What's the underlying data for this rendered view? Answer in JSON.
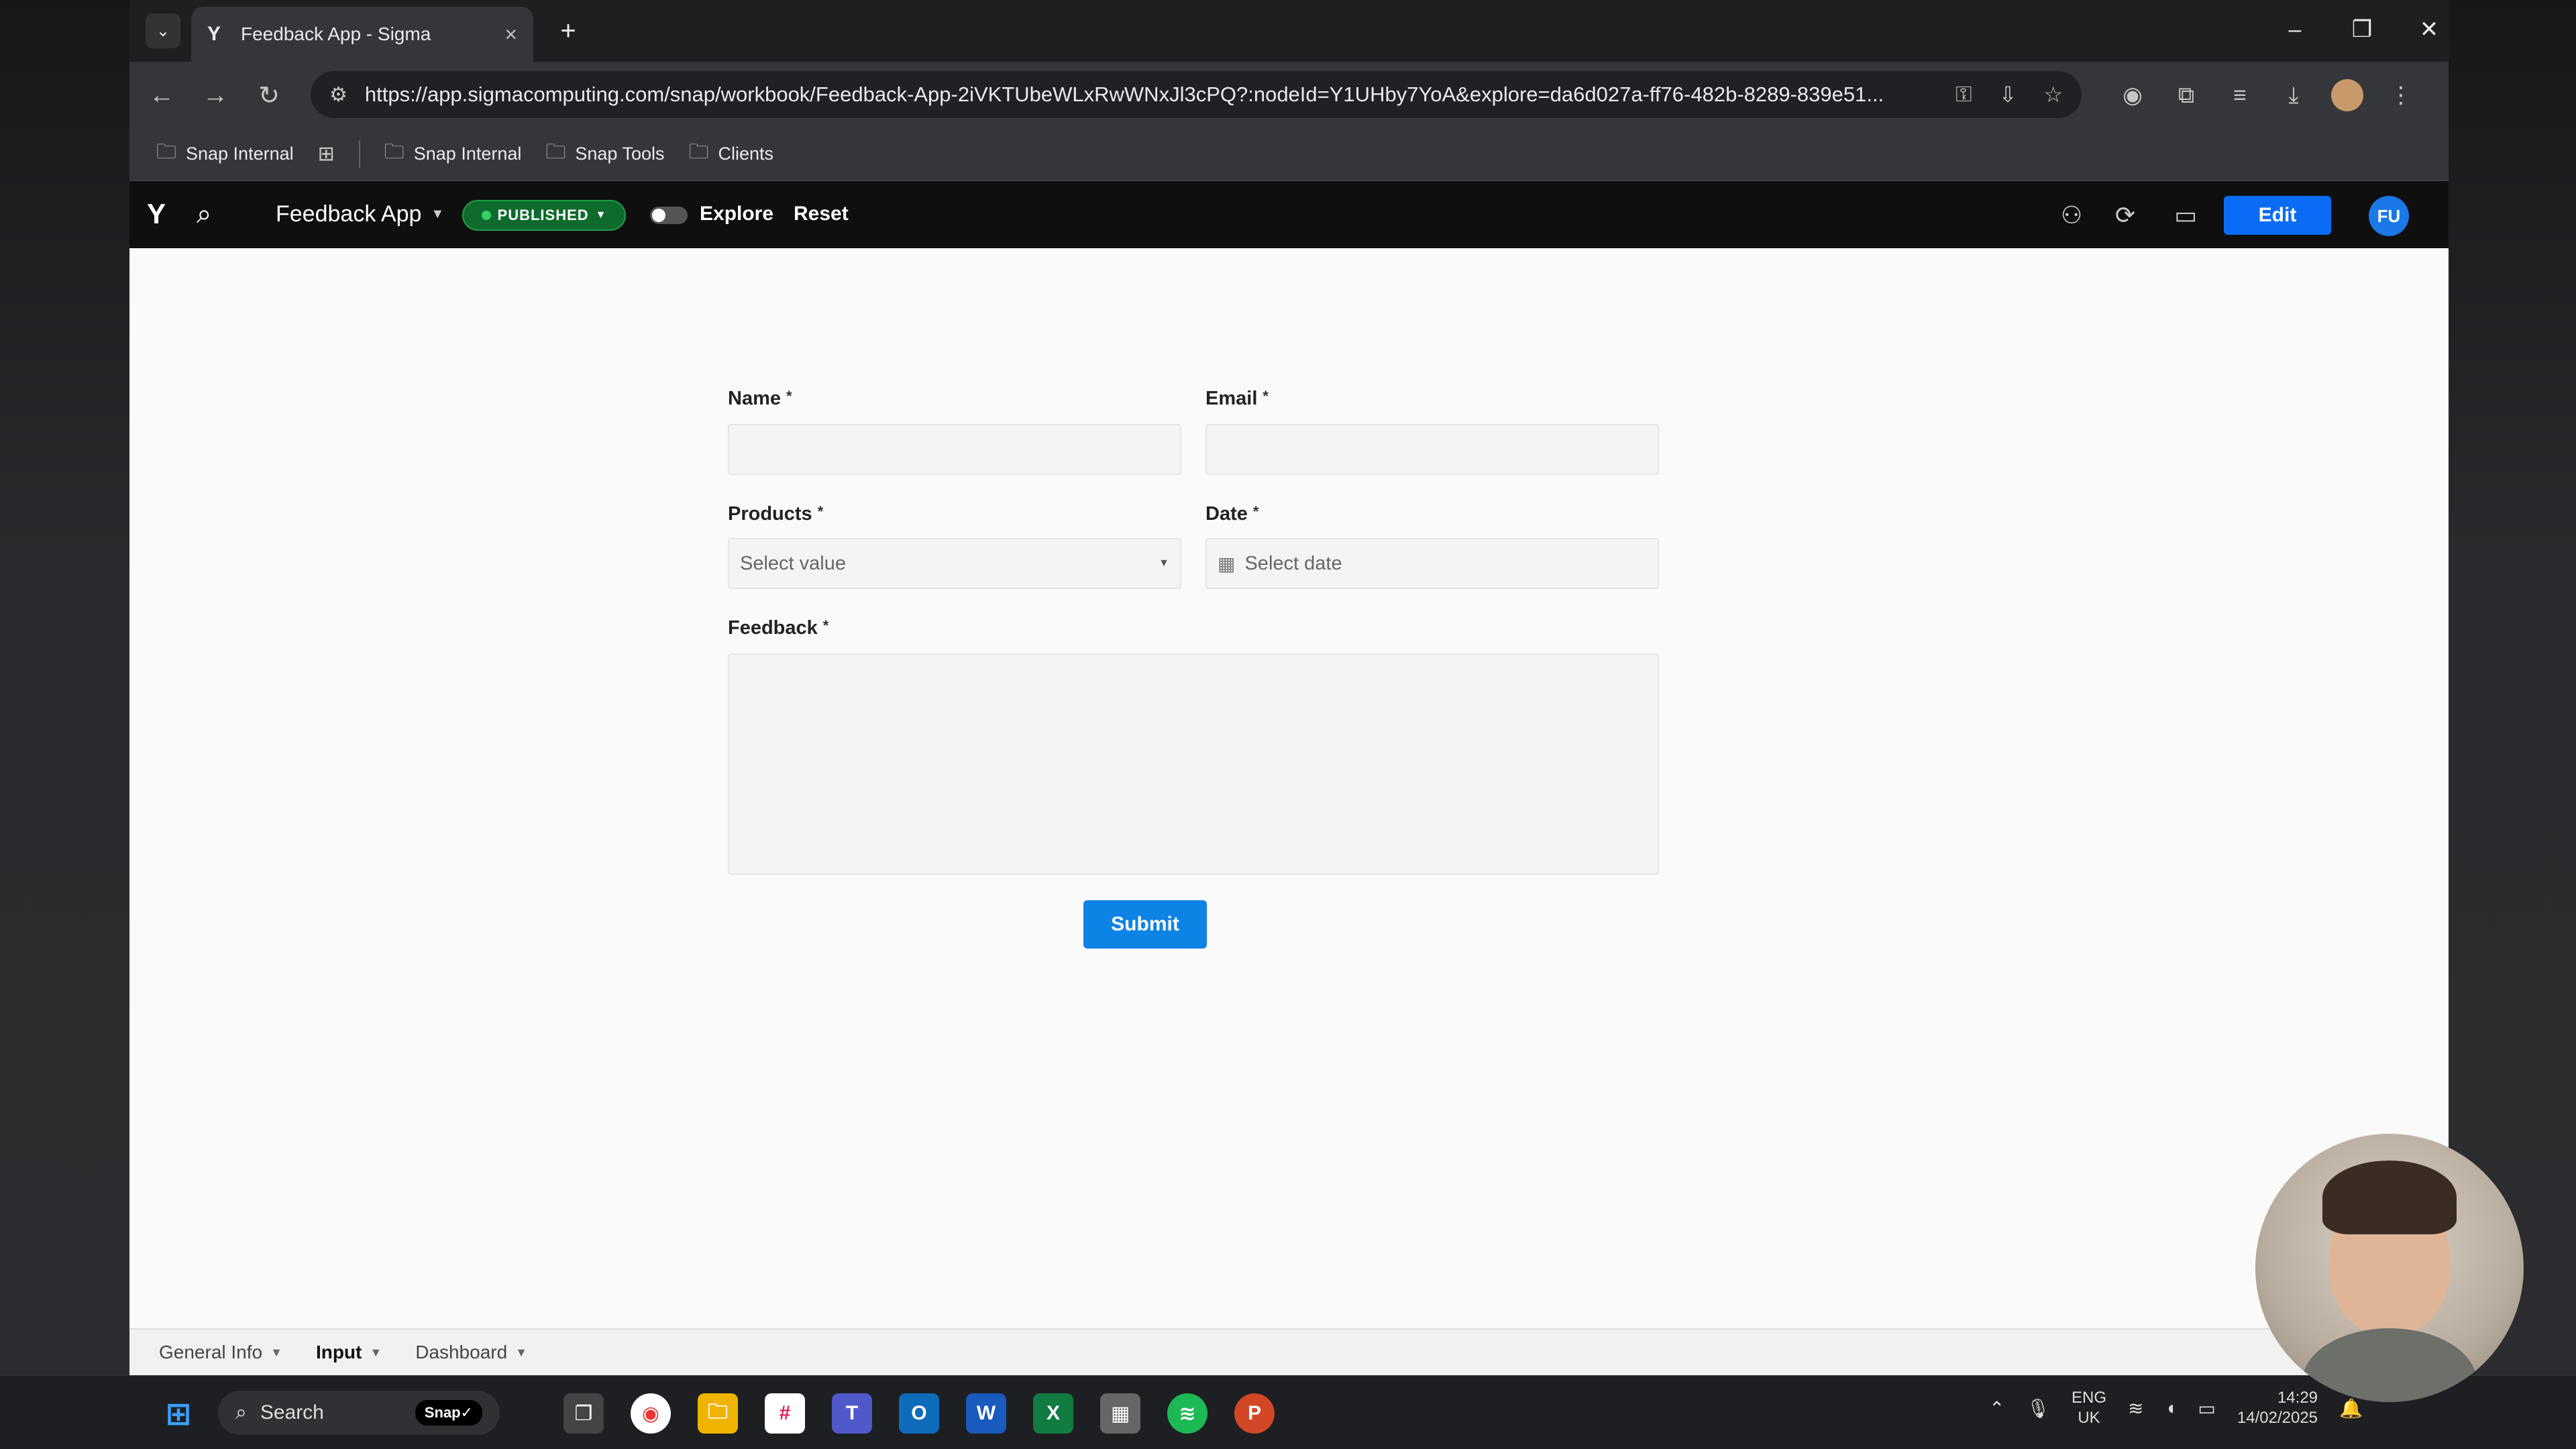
{
  "browser": {
    "tab_title": "Feedback App - Sigma",
    "url": "https://app.sigmacomputing.com/snap/workbook/Feedback-App-2iVKTUbeWLxRwWNxJl3cPQ?:nodeId=Y1UHby7YoA&explore=da6d027a-ff76-482b-8289-839e51...",
    "bookmarks": [
      "Snap Internal",
      "Snap Internal",
      "Snap Tools",
      "Clients"
    ]
  },
  "app": {
    "workbook_name": "Feedback App",
    "status": "PUBLISHED",
    "explore_label": "Explore",
    "reset_label": "Reset",
    "edit_label": "Edit",
    "user_initials": "FU"
  },
  "form": {
    "name_label": "Name",
    "email_label": "Email",
    "products_label": "Products",
    "products_placeholder": "Select value",
    "date_label": "Date",
    "date_placeholder": "Select date",
    "feedback_label": "Feedback",
    "required_mark": "*",
    "submit_label": "Submit"
  },
  "page_tabs": [
    {
      "label": "General Info"
    },
    {
      "label": "Input"
    },
    {
      "label": "Dashboard"
    }
  ],
  "taskbar": {
    "search_label": "Search",
    "snap_label": "Snap✓",
    "lang_line1": "ENG",
    "lang_line2": "UK",
    "time": "14:29",
    "date": "14/02/2025"
  },
  "colors": {
    "edit_button": "#0a6cf5",
    "submit_button": "#0e83e6",
    "published_badge": "#0e6b2d"
  }
}
